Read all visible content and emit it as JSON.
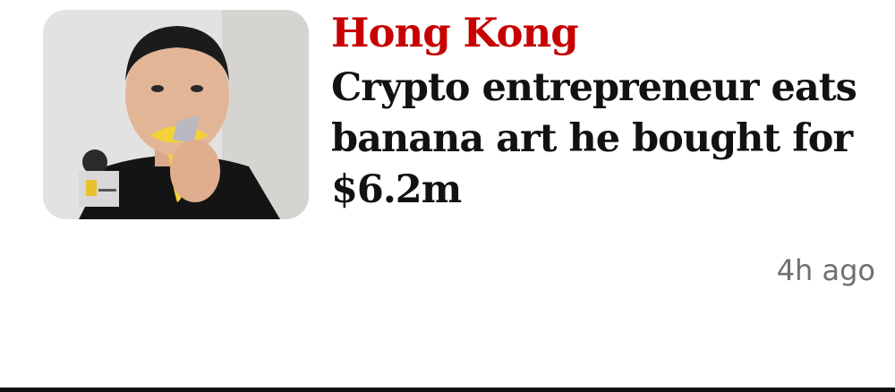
{
  "article": {
    "kicker": "Hong Kong",
    "headline": "Crypto entrepreneur eats banana art he bought for $6.2m",
    "timestamp": "4h ago",
    "image_description": "",
    "accent_color": "#c70000"
  }
}
